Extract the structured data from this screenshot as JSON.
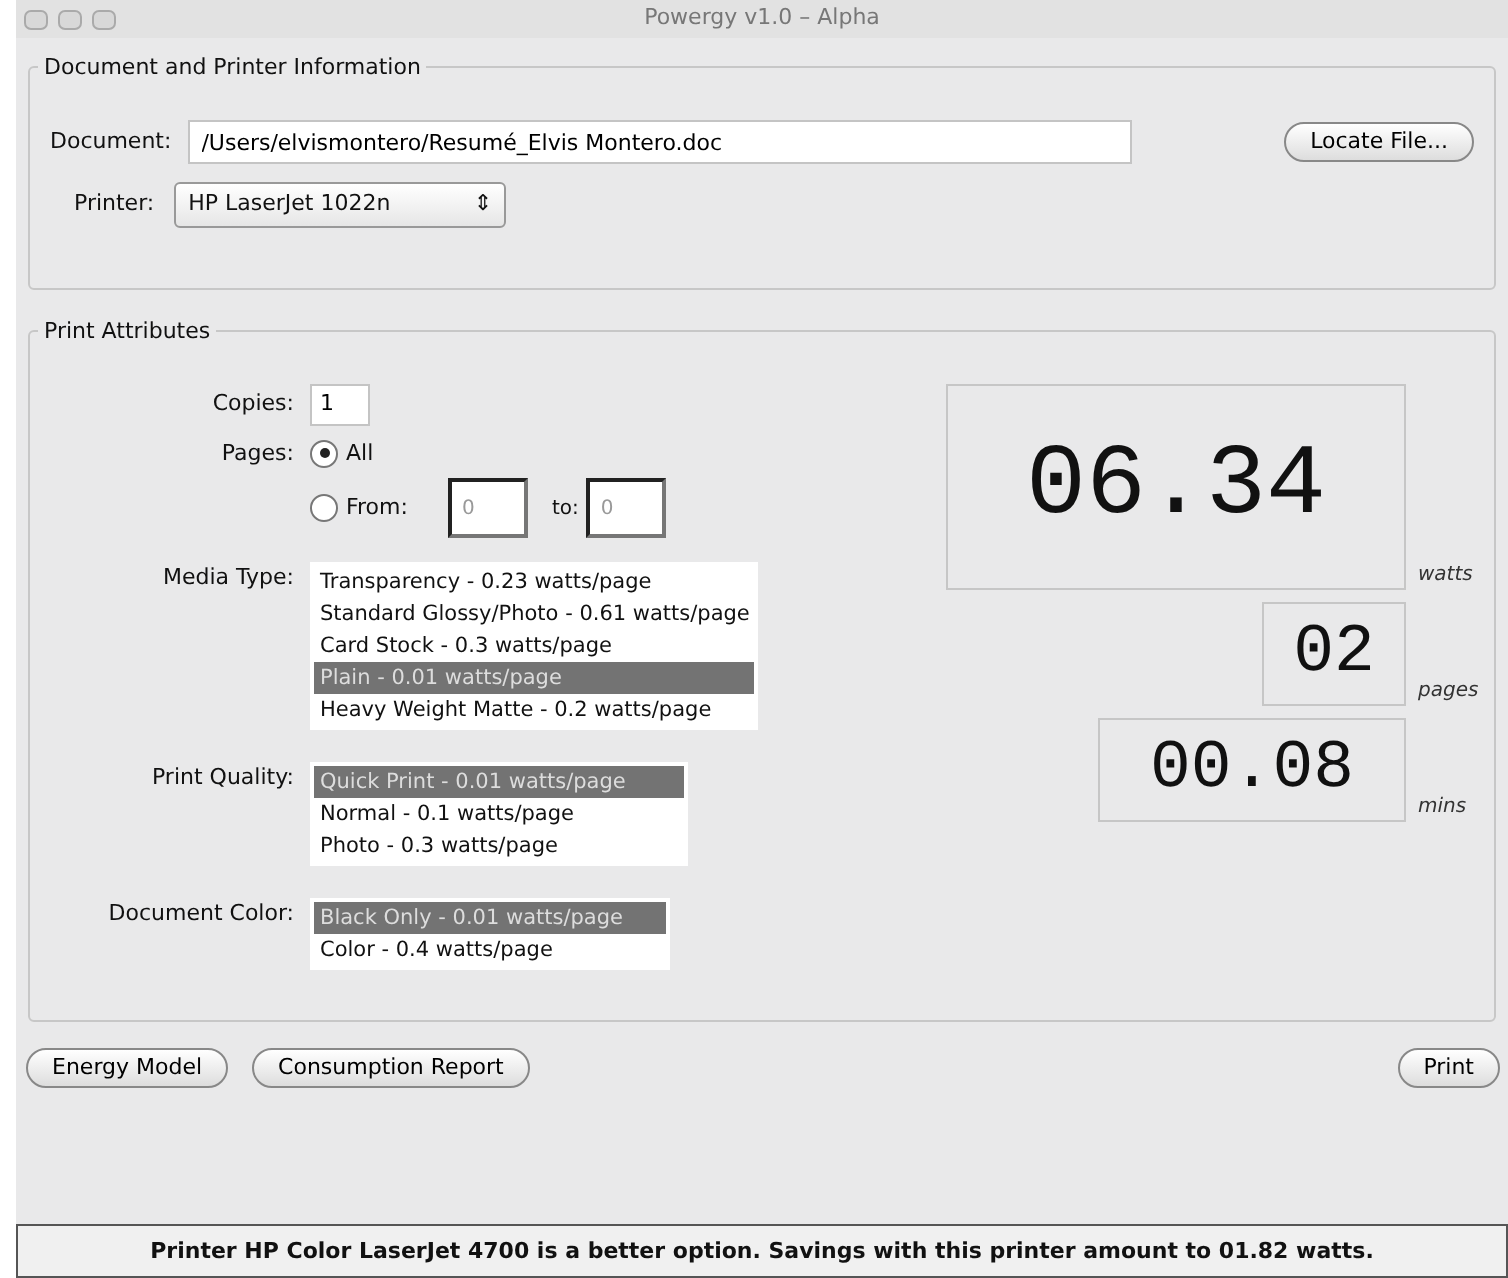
{
  "window": {
    "title": "Powergy v1.0 – Alpha"
  },
  "document_section": {
    "legend": "Document and Printer Information",
    "document_label": "Document:",
    "document_value": "/Users/elvismontero/Resumé_Elvis Montero.doc",
    "locate_button": "Locate File...",
    "printer_label": "Printer:",
    "printer_value": "HP LaserJet 1022n",
    "printer_arrows": "⇕"
  },
  "print_section": {
    "legend": "Print Attributes",
    "copies_label": "Copies:",
    "copies_value": "1",
    "pages_label": "Pages:",
    "page_options": [
      {
        "kind": "all",
        "label": "All",
        "selected": true
      },
      {
        "kind": "range",
        "label": "From:",
        "selected": false,
        "from_value": "0",
        "to_label": "to:",
        "to_value": "0"
      }
    ],
    "lists": [
      {
        "label": "Media Type:",
        "items": [
          {
            "label": "Transparency - 0.23 watts/page",
            "selected": false
          },
          {
            "label": "Standard Glossy/Photo - 0.61 watts/page",
            "selected": false
          },
          {
            "label": "Card Stock - 0.3 watts/page",
            "selected": false
          },
          {
            "label": "Plain - 0.01 watts/page",
            "selected": true
          },
          {
            "label": "Heavy Weight Matte - 0.2 watts/page",
            "selected": false
          }
        ]
      },
      {
        "label": "Print Quality:",
        "items": [
          {
            "label": "Quick Print - 0.01 watts/page",
            "selected": true
          },
          {
            "label": "Normal - 0.1 watts/page",
            "selected": false
          },
          {
            "label": "Photo - 0.3 watts/page",
            "selected": false
          }
        ]
      },
      {
        "label": "Document Color:",
        "items": [
          {
            "label": "Black Only - 0.01 watts/page",
            "selected": true
          },
          {
            "label": "Color - 0.4 watts/page",
            "selected": false
          }
        ]
      }
    ],
    "readouts": [
      {
        "kind": "large",
        "value": "06.34",
        "unit": "watts"
      },
      {
        "kind": "small",
        "value": "02",
        "unit": "pages"
      },
      {
        "kind": "medium",
        "value": "00.08",
        "unit": "mins"
      }
    ]
  },
  "left_buttons": [
    "Energy Model",
    "Consumption Report"
  ],
  "right_buttons": [
    "Print"
  ],
  "status_bar": "Printer HP Color LaserJet 4700 is a better option. Savings with this printer amount to 01.82 watts."
}
